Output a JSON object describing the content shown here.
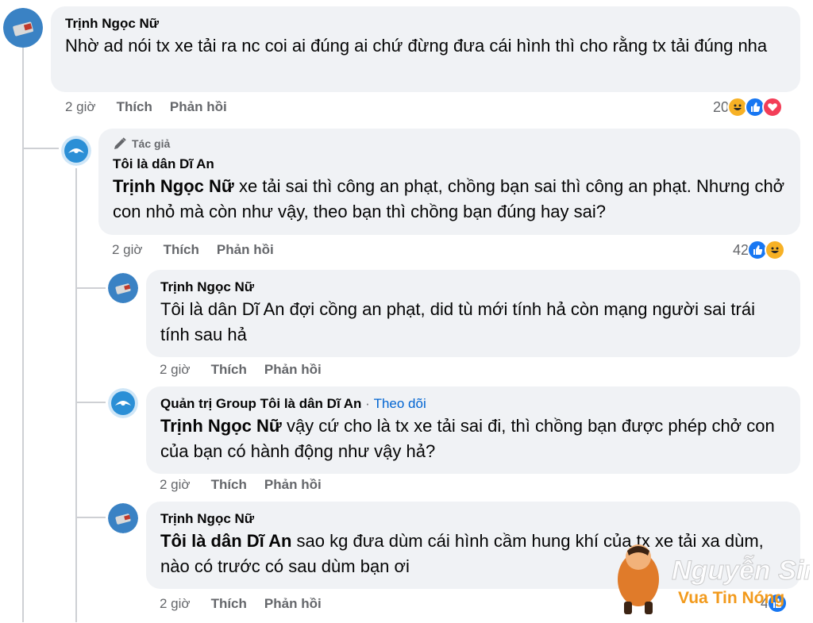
{
  "comments": [
    {
      "author": "Trịnh Ngọc Nữ",
      "text": "Nhờ ad nói tx xe tải ra nc coi ai đúng ai chứ đừng đưa cái hình thì cho rằng tx tải đúng nha",
      "time": "2 giờ",
      "like": "Thích",
      "reply": "Phản hồi",
      "reaction_count": "20"
    },
    {
      "badge": "Tác giả",
      "author": "Tôi là dân Dĩ An",
      "mention": "Trịnh Ngọc Nữ",
      "text": " xe tải sai thì công an phạt, chồng bạn sai thì công an phạt. Nhưng chở con nhỏ mà còn như vậy, theo bạn thì chồng bạn đúng hay sai?",
      "time": "2 giờ",
      "like": "Thích",
      "reply": "Phản hồi",
      "reaction_count": "42"
    },
    {
      "author": "Trịnh Ngọc Nữ",
      "text": "Tôi là dân Dĩ An đợi cồng an phạt, did tù mới tính hả còn mạng người sai trái tính sau hả",
      "time": "2 giờ",
      "like": "Thích",
      "reply": "Phản hồi"
    },
    {
      "author": "Quản trị Group Tôi là dân Dĩ An",
      "separator": "·",
      "follow": "Theo dõi",
      "mention": "Trịnh Ngọc Nữ",
      "text": " vậy cứ cho là tx xe tải sai đi, thì chồng bạn được phép chở con của bạn có hành động như vậy hả?",
      "time": "2 giờ",
      "like": "Thích",
      "reply": "Phản hồi"
    },
    {
      "author": "Trịnh Ngọc Nữ",
      "mention": "Tôi là dân Dĩ An",
      "text": " sao kg đưa dùm cái hình cầm hung khí của tx xe tải xa dùm, nào có trước có sau dùm bạn ơi",
      "time": "2 giờ",
      "like": "Thích",
      "reply": "Phản hồi",
      "reaction_count": "4"
    }
  ],
  "watermark": {
    "name": "Nguyễn Sin",
    "tagline": "Vua Tin Nóng"
  },
  "colors": {
    "bubble": "#f0f2f5",
    "meta": "#65676b",
    "link": "#0064d1",
    "like": "#1877f2",
    "haha": "#f7b125",
    "love": "#f33e58"
  }
}
